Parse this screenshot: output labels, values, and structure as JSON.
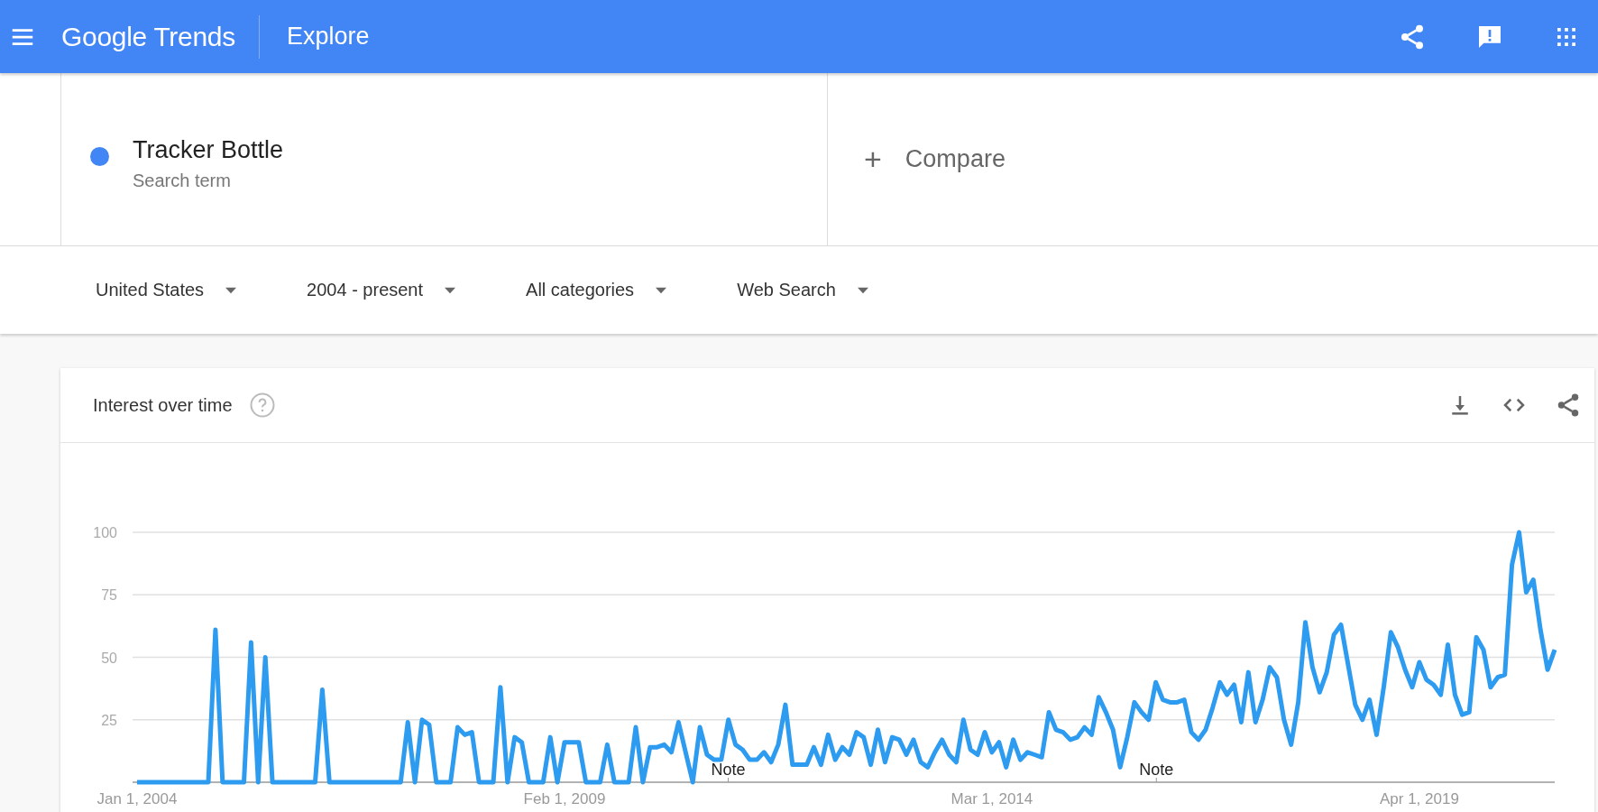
{
  "header": {
    "logo": "Google Trends",
    "title": "Explore"
  },
  "search_term": {
    "term": "Tracker Bottle",
    "subtitle": "Search term",
    "color": "#4285f4"
  },
  "compare": {
    "icon": "+",
    "label": "Compare"
  },
  "filters": [
    {
      "label": "United States"
    },
    {
      "label": "2004 - present"
    },
    {
      "label": "All categories"
    },
    {
      "label": "Web Search"
    }
  ],
  "interest_over_time": {
    "title": "Interest over time",
    "chart_data": {
      "type": "line",
      "categories": [
        "Jan 1, 2004",
        null,
        null,
        null,
        null,
        null,
        null,
        null,
        null,
        null,
        null,
        null,
        null,
        null,
        null,
        null,
        null,
        null,
        null,
        null,
        null,
        null,
        null,
        null,
        null,
        null,
        null,
        null,
        null,
        null,
        null,
        null,
        null,
        null,
        null,
        null,
        null,
        null,
        null,
        null,
        null,
        null,
        null,
        null,
        null,
        null,
        null,
        null,
        null,
        null,
        null,
        null,
        null,
        null,
        null,
        null,
        null,
        null,
        null,
        null,
        "Feb 1, 2009",
        null,
        null,
        null,
        null,
        null,
        null,
        null,
        null,
        null,
        null,
        null,
        null,
        null,
        null,
        null,
        null,
        null,
        null,
        null,
        null,
        null,
        null,
        null,
        null,
        null,
        null,
        null,
        null,
        null,
        null,
        null,
        null,
        null,
        null,
        null,
        null,
        null,
        null,
        null,
        null,
        null,
        null,
        null,
        null,
        null,
        null,
        null,
        null,
        null,
        null,
        null,
        null,
        null,
        null,
        null,
        null,
        null,
        null,
        null,
        "Mar 1, 2014",
        null,
        null,
        null,
        null,
        null,
        null,
        null,
        null,
        null,
        null,
        null,
        null,
        null,
        null,
        null,
        null,
        null,
        null,
        null,
        null,
        null,
        null,
        null,
        null,
        null,
        null,
        null,
        null,
        null,
        null,
        null,
        null,
        null,
        null,
        null,
        null,
        null,
        null,
        null,
        null,
        null,
        null,
        null,
        null,
        null,
        null,
        null,
        null,
        null,
        null,
        null,
        null,
        null,
        null,
        null,
        null,
        null,
        null,
        null,
        "Apr 1, 2019",
        null,
        null,
        null,
        null,
        null,
        null,
        null,
        null,
        null,
        null,
        null,
        null,
        null,
        null,
        null,
        null,
        null,
        null,
        null
      ],
      "series": [
        {
          "color": "#2d9bf0",
          "values": [
            0,
            0,
            0,
            0,
            0,
            0,
            0,
            0,
            0,
            0,
            0,
            61,
            0,
            0,
            0,
            0,
            56,
            0,
            50,
            0,
            0,
            0,
            0,
            0,
            0,
            0,
            37,
            0,
            0,
            0,
            0,
            0,
            0,
            0,
            0,
            0,
            0,
            0,
            24,
            0,
            25,
            23,
            0,
            0,
            0,
            22,
            19,
            20,
            0,
            0,
            0,
            38,
            0,
            18,
            16,
            0,
            0,
            0,
            18,
            0,
            16,
            16,
            16,
            0,
            0,
            0,
            15,
            0,
            0,
            0,
            22,
            0,
            14,
            14,
            15,
            12,
            24,
            12,
            0,
            22,
            11,
            9,
            9,
            25,
            15,
            13,
            9,
            9,
            12,
            8,
            15,
            31,
            7,
            7,
            7,
            14,
            7,
            19,
            9,
            14,
            11,
            20,
            18,
            7,
            21,
            8,
            18,
            17,
            11,
            17,
            8,
            6,
            12,
            17,
            11,
            8,
            25,
            13,
            11,
            20,
            12,
            16,
            6,
            17,
            9,
            12,
            11,
            10,
            28,
            21,
            20,
            17,
            18,
            22,
            19,
            34,
            28,
            21,
            6,
            18,
            32,
            28,
            25,
            40,
            33,
            32,
            32,
            33,
            20,
            17,
            21,
            30,
            40,
            35,
            39,
            24,
            44,
            24,
            33,
            46,
            42,
            25,
            15,
            32,
            64,
            46,
            36,
            44,
            59,
            63,
            47,
            31,
            25,
            33,
            19,
            38,
            60,
            54,
            45,
            38,
            48,
            41,
            39,
            35,
            55,
            35,
            27,
            28,
            58,
            53,
            38,
            42,
            43,
            87,
            100,
            76,
            81,
            61,
            45,
            53
          ]
        }
      ],
      "ylim": [
        0,
        100
      ],
      "grid": true,
      "yticks": [
        25,
        50,
        75,
        100
      ],
      "annotations": [
        "Note",
        "Note"
      ]
    }
  }
}
